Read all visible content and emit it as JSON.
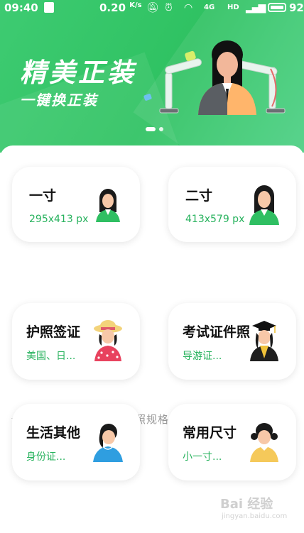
{
  "status_bar": {
    "time": "09:40",
    "speed": "0.20",
    "speed_unit": "K/s",
    "network_4g": "4G",
    "network_hd": "HD",
    "battery": "92"
  },
  "banner": {
    "title": "精美正装",
    "subtitle": "一键换正装"
  },
  "sizes": [
    {
      "title": "一寸",
      "dims": "295x413 px"
    },
    {
      "title": "二寸",
      "dims": "413x579 px"
    }
  ],
  "section_label": "证件照规格分类",
  "categories": [
    {
      "title": "护照签证",
      "sub": "美国、日..."
    },
    {
      "title": "考试证件照",
      "sub": "导游证..."
    },
    {
      "title": "生活其他",
      "sub": "身份证..."
    },
    {
      "title": "常用尺寸",
      "sub": "小一寸..."
    }
  ],
  "watermark": {
    "text": "Bai 经验",
    "url": "jingyan.baidu.com"
  },
  "colors": {
    "brand_green": "#2fc262",
    "accent_green": "#27b25d"
  }
}
